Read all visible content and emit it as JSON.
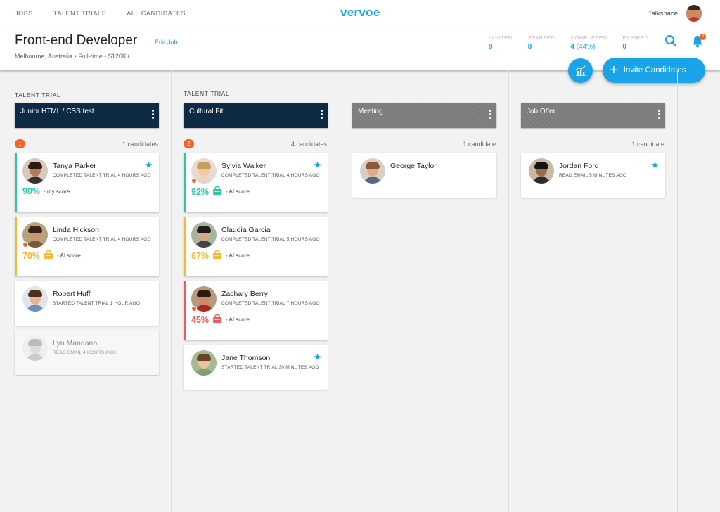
{
  "nav": {
    "items": [
      "JOBS",
      "TALENT TRIALS",
      "ALL CANDIDATES"
    ],
    "logo": "vervoe",
    "company": "Talkspace"
  },
  "job": {
    "title": "Front-end Developer",
    "edit_label": "Edit Job",
    "meta": "Melbourne, Australia  •  Full-time  •  $120K+",
    "stats": [
      {
        "label": "INVITED",
        "value": "9",
        "pct": ""
      },
      {
        "label": "STARTED",
        "value": "8",
        "pct": ""
      },
      {
        "label": "COMPLETED",
        "value": "4",
        "pct": "(44%)"
      },
      {
        "label": "EXPIRED",
        "value": "0",
        "pct": ""
      }
    ],
    "notifications": "8"
  },
  "actions": {
    "invite_label": "Invite Candidates"
  },
  "colors": {
    "accent": "#1aa3e8",
    "green": "#2ec4a6",
    "yellow": "#f5b82e",
    "red": "#ef5b5b",
    "orange": "#f06524",
    "dark_header": "#0d2b45"
  },
  "columns": [
    {
      "label": "TALENT TRIAL",
      "title": "Junior HTML / CSS test",
      "badge": "1",
      "count": "1 candidates",
      "cards": [
        {
          "name": "Tanya Parker",
          "status": "COMPLETED TALENT TRIAL 4 HOURS AGO",
          "score": "90%",
          "score_label": "- my score",
          "star": true
        },
        {
          "name": "Linda Hickson",
          "status": "COMPLETED TALENT TRIAL 4 HOURS AGO",
          "score": "70%",
          "score_label": "- AI score"
        },
        {
          "name": "Robert Huff",
          "status": "STARTED TALENT TRIAL 1 HOUR AGO"
        },
        {
          "name": "Lyn Mandano",
          "status": "READ EMAIL 4 HOURS AGO"
        }
      ]
    },
    {
      "label": "TALENT TRIAL",
      "title": "Cultural Fit",
      "badge": "2",
      "count": "4 candidates",
      "cards": [
        {
          "name": "Sylvia Walker",
          "status": "COMPLETED TALENT TRIAL 4 HOURS AGO",
          "score": "92%",
          "score_label": "- AI score",
          "star": true
        },
        {
          "name": "Claudia Garcia",
          "status": "COMPLETED TALENT TRIAL 5 HOURS AGO",
          "score": "67%",
          "score_label": "- AI score"
        },
        {
          "name": "Zachary Berry",
          "status": "COMPLETED TALENT TRIAL 7 HOURS AGO",
          "score": "45%",
          "score_label": "- AI score"
        },
        {
          "name": "Jane Thomson",
          "status": "STARTED TALENT TRIAL 30 MINUTES AGO",
          "star": true
        }
      ]
    },
    {
      "title": "Meeting",
      "count": "1 candidate",
      "cards": [
        {
          "name": "George Taylor"
        }
      ]
    },
    {
      "title": "Job Offer",
      "count": "1 candidate",
      "cards": [
        {
          "name": "Jordan Ford",
          "status": "READ EMAIL 5 MINUTES AGO",
          "star": true
        }
      ]
    }
  ]
}
